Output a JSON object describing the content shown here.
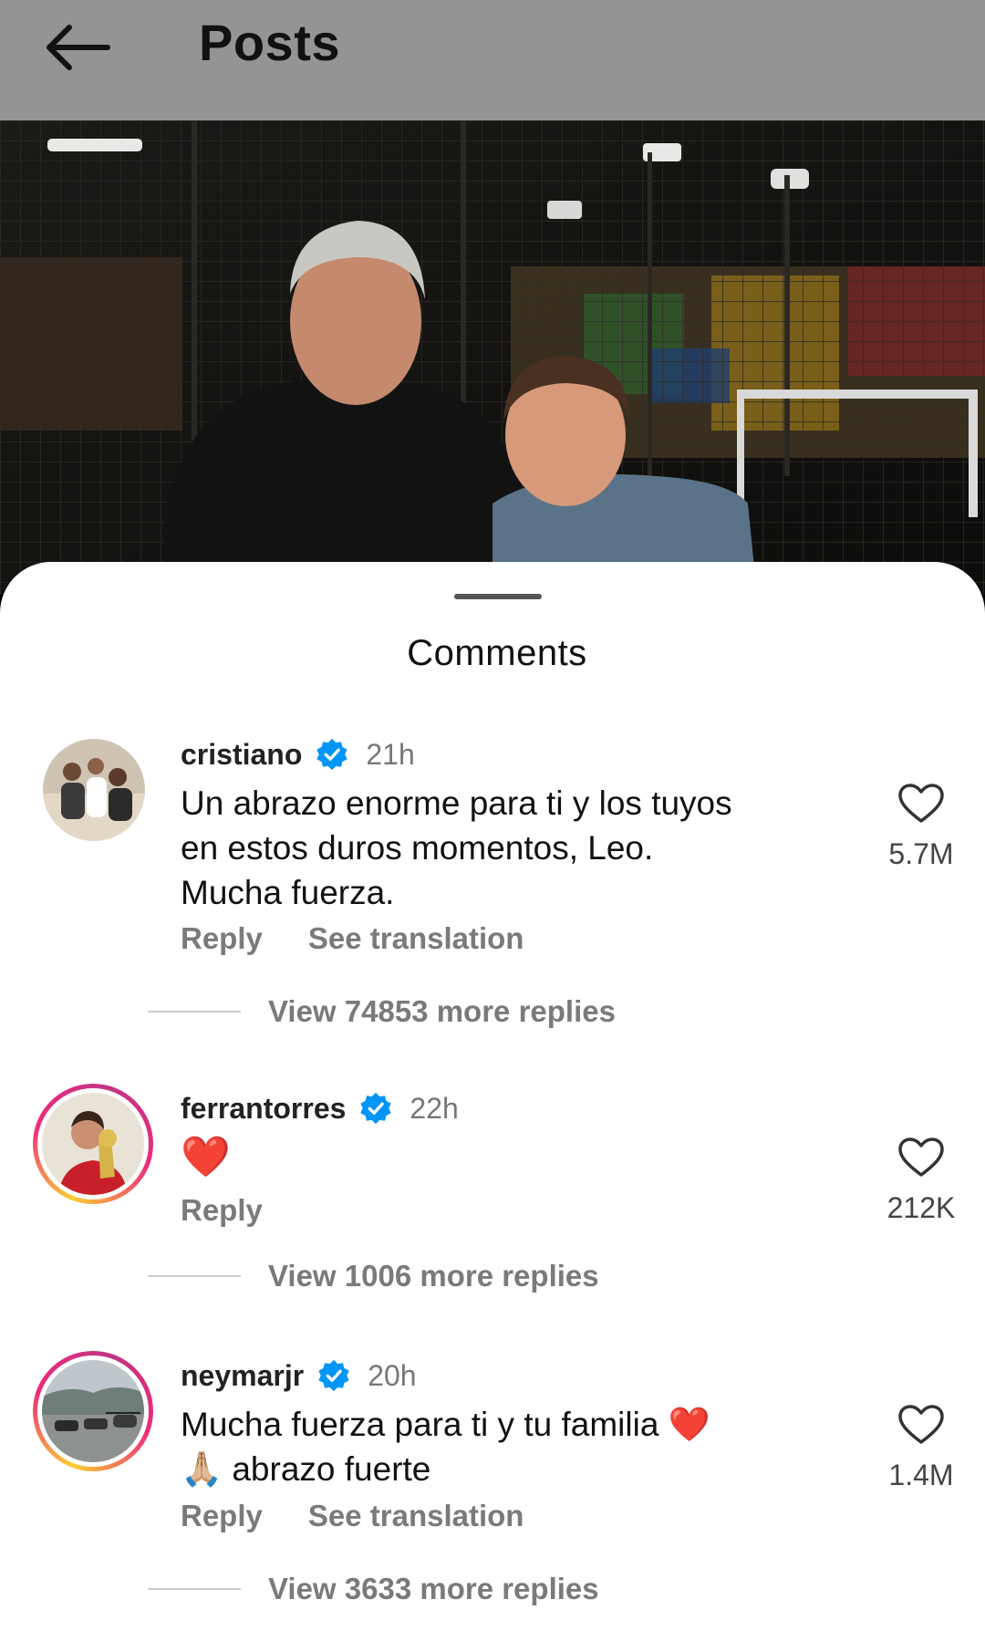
{
  "header": {
    "title": "Posts",
    "back_icon": "arrow-left-icon"
  },
  "sheet": {
    "title": "Comments"
  },
  "comments": [
    {
      "username": "cristiano",
      "time": "21h",
      "text_lines": [
        "Un abrazo enorme para ti y los tuyos",
        "en estos duros momentos, Leo.",
        "Mucha fuerza."
      ],
      "likes": "5.7M",
      "reply_label": "Reply",
      "translate_label": "See translation",
      "view_replies": "View 74853 more replies"
    },
    {
      "username": "ferrantorres",
      "time": "22h",
      "text": "❤️",
      "likes": "212K",
      "reply_label": "Reply",
      "view_replies": "View 1006 more replies"
    },
    {
      "username": "neymarjr",
      "time": "20h",
      "text_lines": [
        "Mucha fuerza para ti y tu familia ❤️",
        "🙏🏼 abrazo fuerte"
      ],
      "likes": "1.4M",
      "reply_label": "Reply",
      "translate_label": "See translation",
      "view_replies": "View 3633 more replies"
    }
  ],
  "colors": {
    "verified": "#0095f6",
    "muted_text": "#7a7a7a",
    "header_bg": "#949494"
  }
}
